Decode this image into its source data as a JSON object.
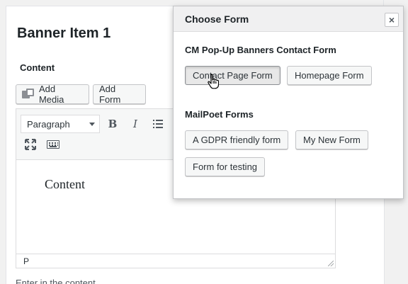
{
  "postbox": {
    "title": "Banner Item 1",
    "content_label": "Content",
    "add_media_label": "Add Media",
    "add_form_label": "Add Form"
  },
  "editor": {
    "format_value": "Paragraph",
    "bold_label": "B",
    "italic_label": "I",
    "content_text": "Content",
    "status_path": "P",
    "help_text": "Enter in the content"
  },
  "popup": {
    "title": "Choose Form",
    "close_label": "×",
    "groups": [
      {
        "title": "CM Pop-Up Banners Contact Form",
        "forms": [
          "Contact Page Form",
          "Homepage Form"
        ]
      },
      {
        "title": "MailPoet Forms",
        "forms": [
          "A GDPR friendly form",
          "My New Form",
          "Form for testing"
        ]
      }
    ]
  },
  "colors": {
    "page_bg": "#f1f1f1",
    "button_bg": "#f6f7f7",
    "button_border": "#c3c4c7",
    "text": "#2c3338"
  },
  "icons": {
    "add_media": "media-icon",
    "bold": "bold-icon",
    "italic": "italic-icon",
    "list": "bullet-list-icon",
    "fullscreen": "expand-icon",
    "toolbar_toggle": "keyboard-icon",
    "close": "close-icon",
    "cursor": "hand-pointer-icon"
  }
}
